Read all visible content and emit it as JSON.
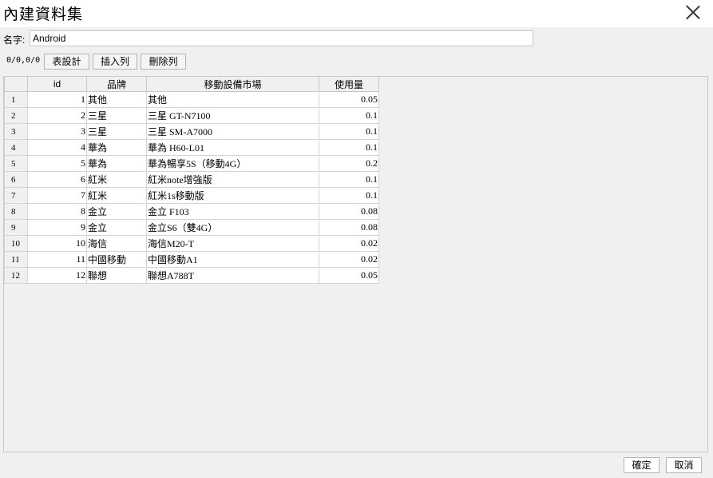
{
  "dialog": {
    "title": "內建資料集"
  },
  "name_field": {
    "label": "名字:",
    "value": "Android"
  },
  "toolbar": {
    "counter": "0/0,0/0",
    "design_label": "表設計",
    "insert_label": "插入列",
    "delete_label": "刪除列"
  },
  "table": {
    "columns": [
      "id",
      "品牌",
      "移動設備市場",
      "使用量"
    ],
    "rows": [
      {
        "n": "1",
        "id": "1",
        "brand": "其他",
        "device": "其他",
        "usage": "0.05"
      },
      {
        "n": "2",
        "id": "2",
        "brand": "三星",
        "device": "三星 GT-N7100",
        "usage": "0.1"
      },
      {
        "n": "3",
        "id": "3",
        "brand": "三星",
        "device": "三星 SM-A7000",
        "usage": "0.1"
      },
      {
        "n": "4",
        "id": "4",
        "brand": "華為",
        "device": "華為 H60-L01",
        "usage": "0.1"
      },
      {
        "n": "5",
        "id": "5",
        "brand": "華為",
        "device": "華為暢享5S（移動4G）",
        "usage": "0.2"
      },
      {
        "n": "6",
        "id": "6",
        "brand": "紅米",
        "device": "紅米note增強版",
        "usage": "0.1"
      },
      {
        "n": "7",
        "id": "7",
        "brand": "紅米",
        "device": "紅米1s移動版",
        "usage": "0.1"
      },
      {
        "n": "8",
        "id": "8",
        "brand": "金立",
        "device": "金立 F103",
        "usage": "0.08"
      },
      {
        "n": "9",
        "id": "9",
        "brand": "金立",
        "device": "金立S6（雙4G）",
        "usage": "0.08"
      },
      {
        "n": "10",
        "id": "10",
        "brand": "海信",
        "device": "海信M20-T",
        "usage": "0.02"
      },
      {
        "n": "11",
        "id": "11",
        "brand": "中國移動",
        "device": "中國移動A1",
        "usage": "0.02"
      },
      {
        "n": "12",
        "id": "12",
        "brand": "聯想",
        "device": "聯想A788T",
        "usage": "0.05"
      }
    ]
  },
  "footer": {
    "ok_label": "確定",
    "cancel_label": "取消"
  }
}
